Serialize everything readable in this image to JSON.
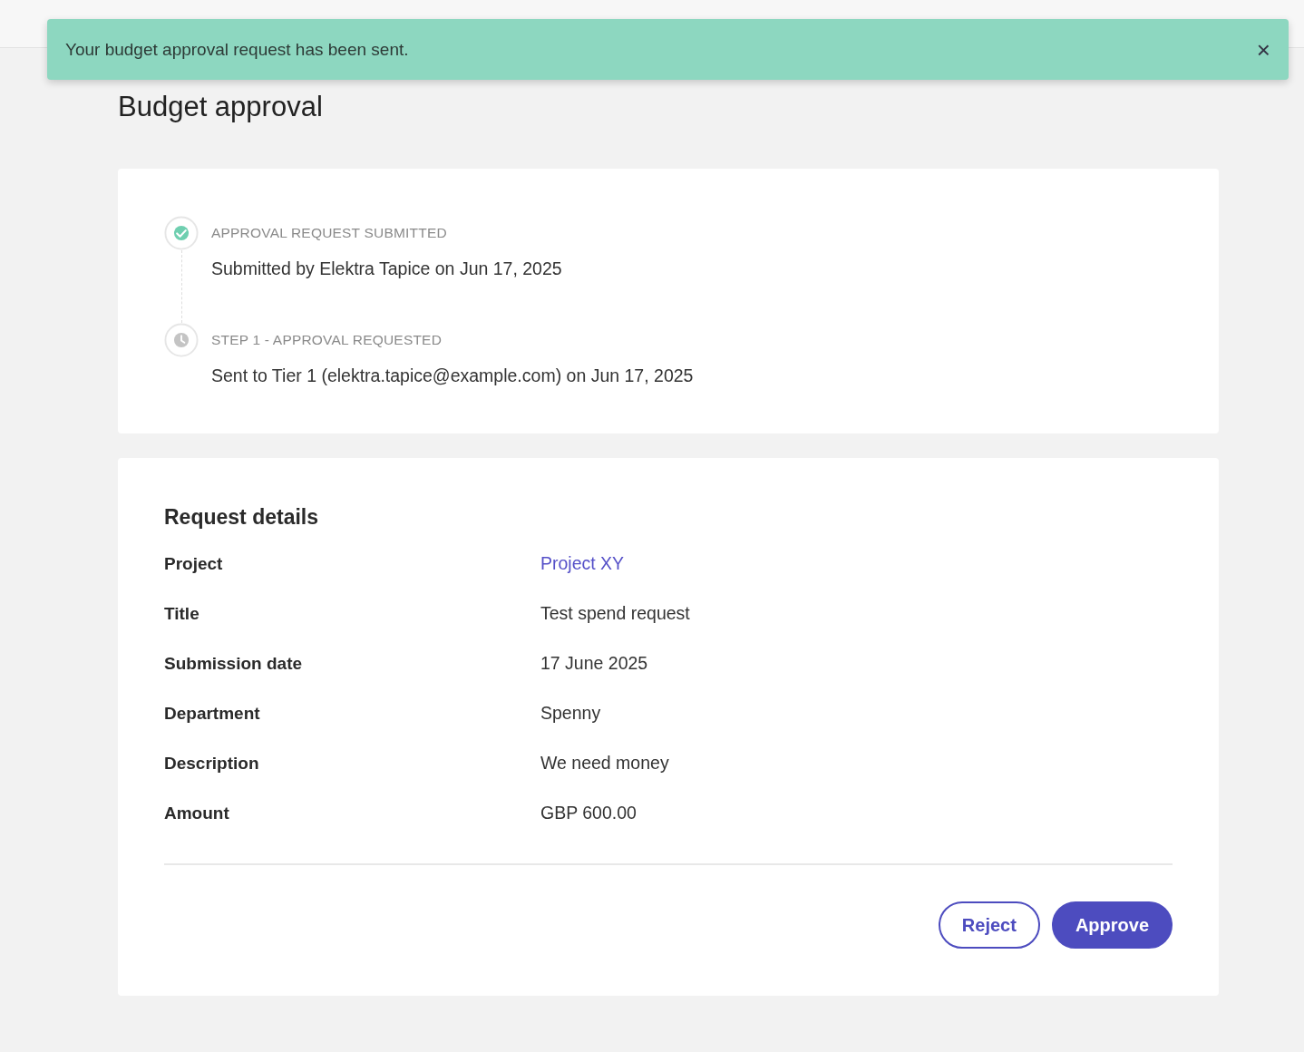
{
  "toast": {
    "message": "Your budget approval request has been sent.",
    "close": "×"
  },
  "page": {
    "title": "Budget approval"
  },
  "timeline": [
    {
      "kind": "done",
      "label": "APPROVAL REQUEST SUBMITTED",
      "text": "Submitted by Elektra Tapice on Jun 17, 2025"
    },
    {
      "kind": "pending",
      "label": "STEP 1 - APPROVAL REQUESTED",
      "text": "Sent to Tier 1 (elektra.tapice@example.com) on Jun 17, 2025"
    }
  ],
  "details": {
    "heading": "Request details",
    "rows": [
      {
        "label": "Project",
        "value": "Project XY",
        "kind": "link"
      },
      {
        "label": "Title",
        "value": "Test spend request",
        "kind": "text"
      },
      {
        "label": "Submission date",
        "value": "17 June 2025",
        "kind": "text"
      },
      {
        "label": "Department",
        "value": "Spenny",
        "kind": "text"
      },
      {
        "label": "Description",
        "value": "We need money",
        "kind": "text"
      },
      {
        "label": "Amount",
        "value": "GBP 600.00",
        "kind": "text"
      }
    ]
  },
  "actions": [
    {
      "label": "Reject",
      "kind": "secondary"
    },
    {
      "label": "Approve",
      "kind": "primary"
    }
  ]
}
